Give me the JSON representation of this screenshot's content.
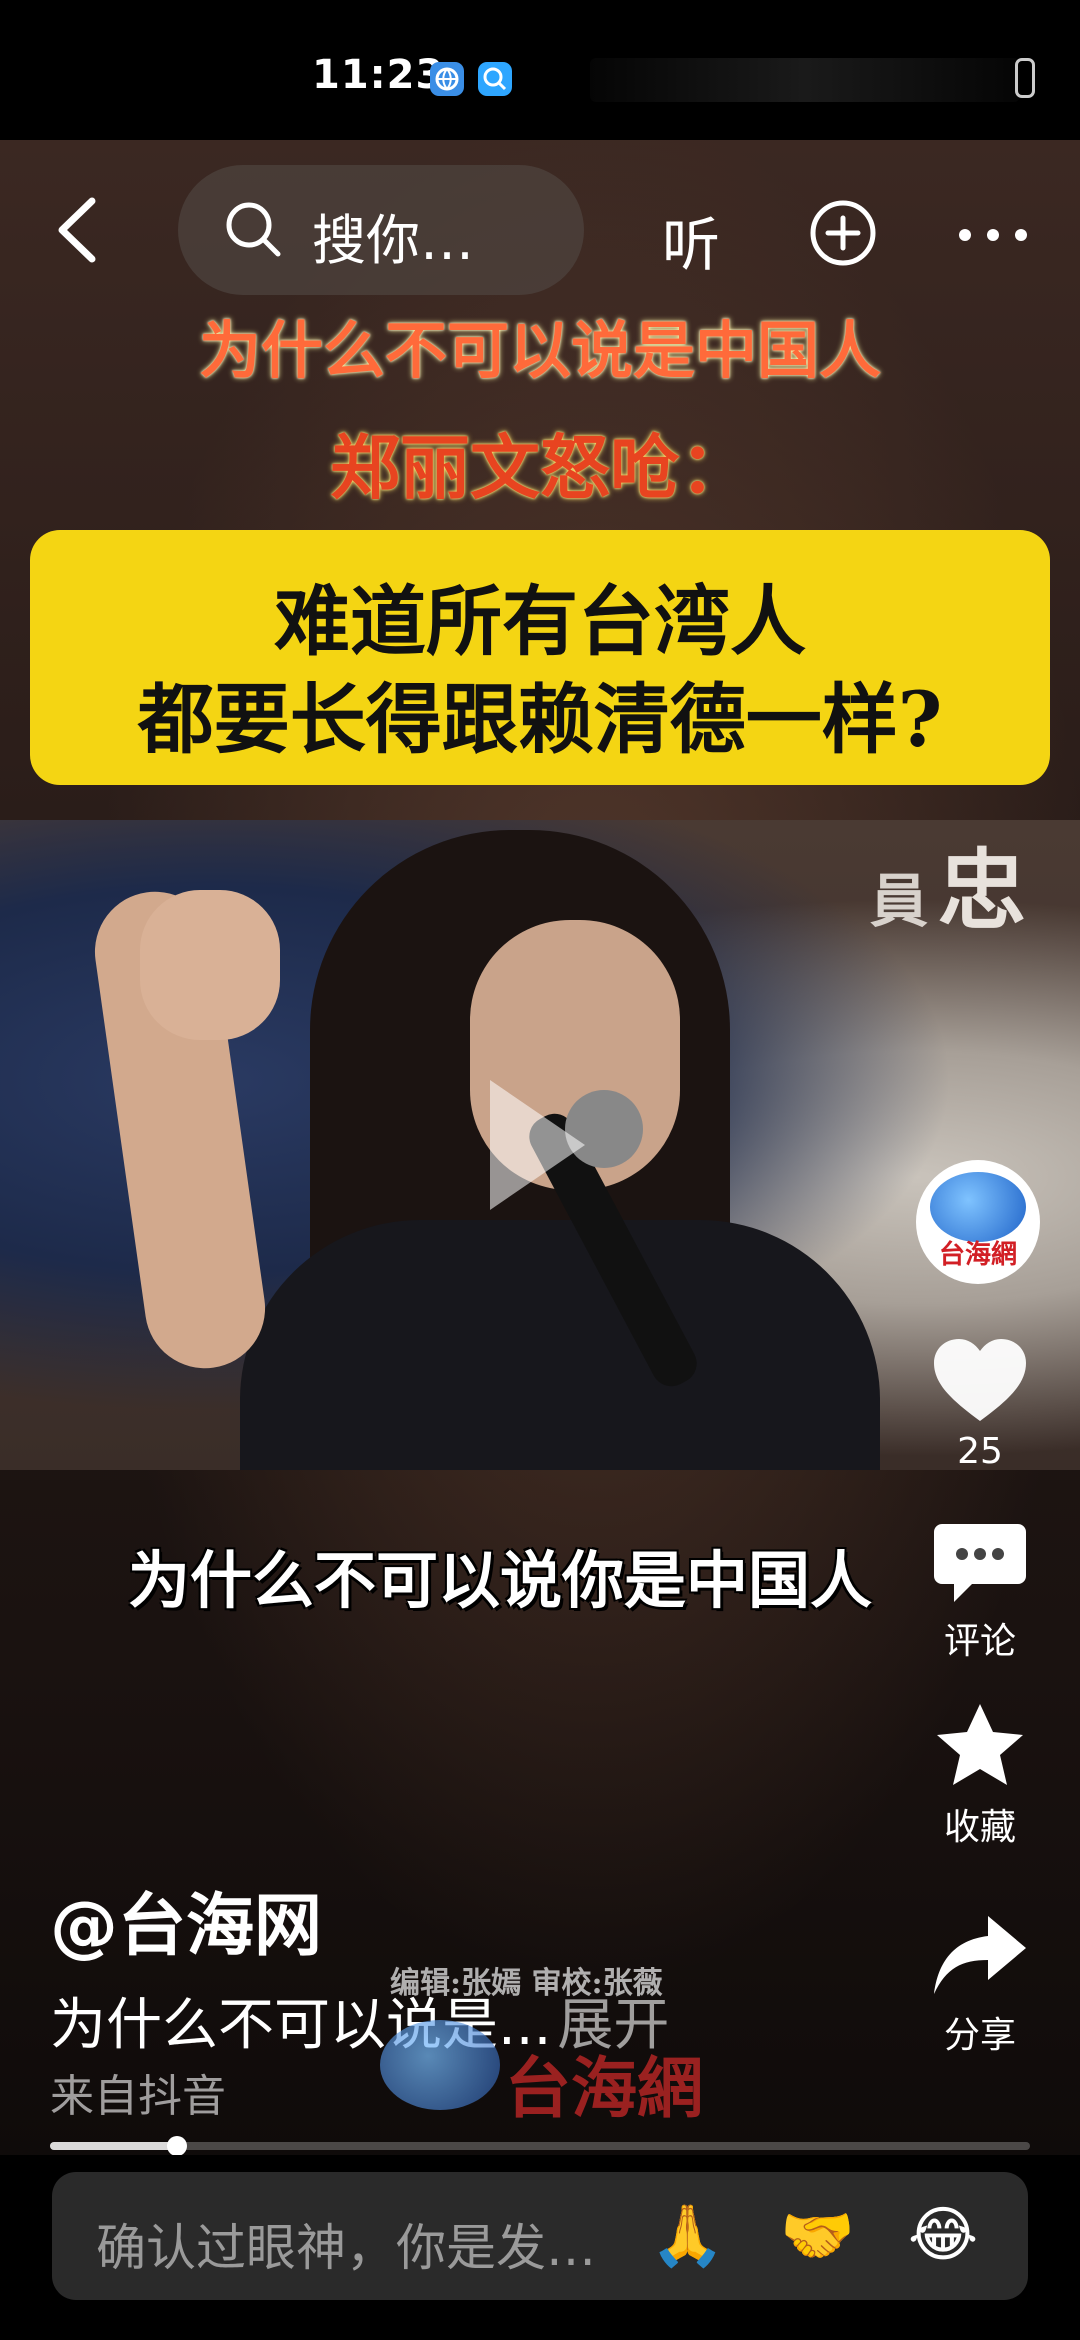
{
  "status_bar": {
    "time": "11:23"
  },
  "top_nav": {
    "search_text": "搜你…",
    "listen_label": "听"
  },
  "video": {
    "headline_1": "为什么不可以说是中国人",
    "headline_2": "郑丽文怒呛：",
    "highlight_line_1": "难道所有台湾人",
    "highlight_line_2": "都要长得跟赖清德一样?",
    "background_text_small": "員",
    "background_text_large": "忠",
    "subtitle": "为什么不可以说你是中国人",
    "watermark_credit": "编辑:张嫣 审校:张薇",
    "watermark_brand": "台海網"
  },
  "right_rail": {
    "account_logo_text": "台海網",
    "like_count": "25",
    "comment_label": "评论",
    "favorite_label": "收藏",
    "share_label": "分享"
  },
  "post_info": {
    "author": "@台海网",
    "description": "为什么不可以说是...",
    "expand_label": "展开",
    "source": "来自抖音"
  },
  "progress": {
    "played_fraction": 0.13
  },
  "comment_bar": {
    "placeholder": "确认过眼神，你是发…",
    "quick_emojis": [
      "🙏",
      "🤝",
      "😂"
    ]
  }
}
